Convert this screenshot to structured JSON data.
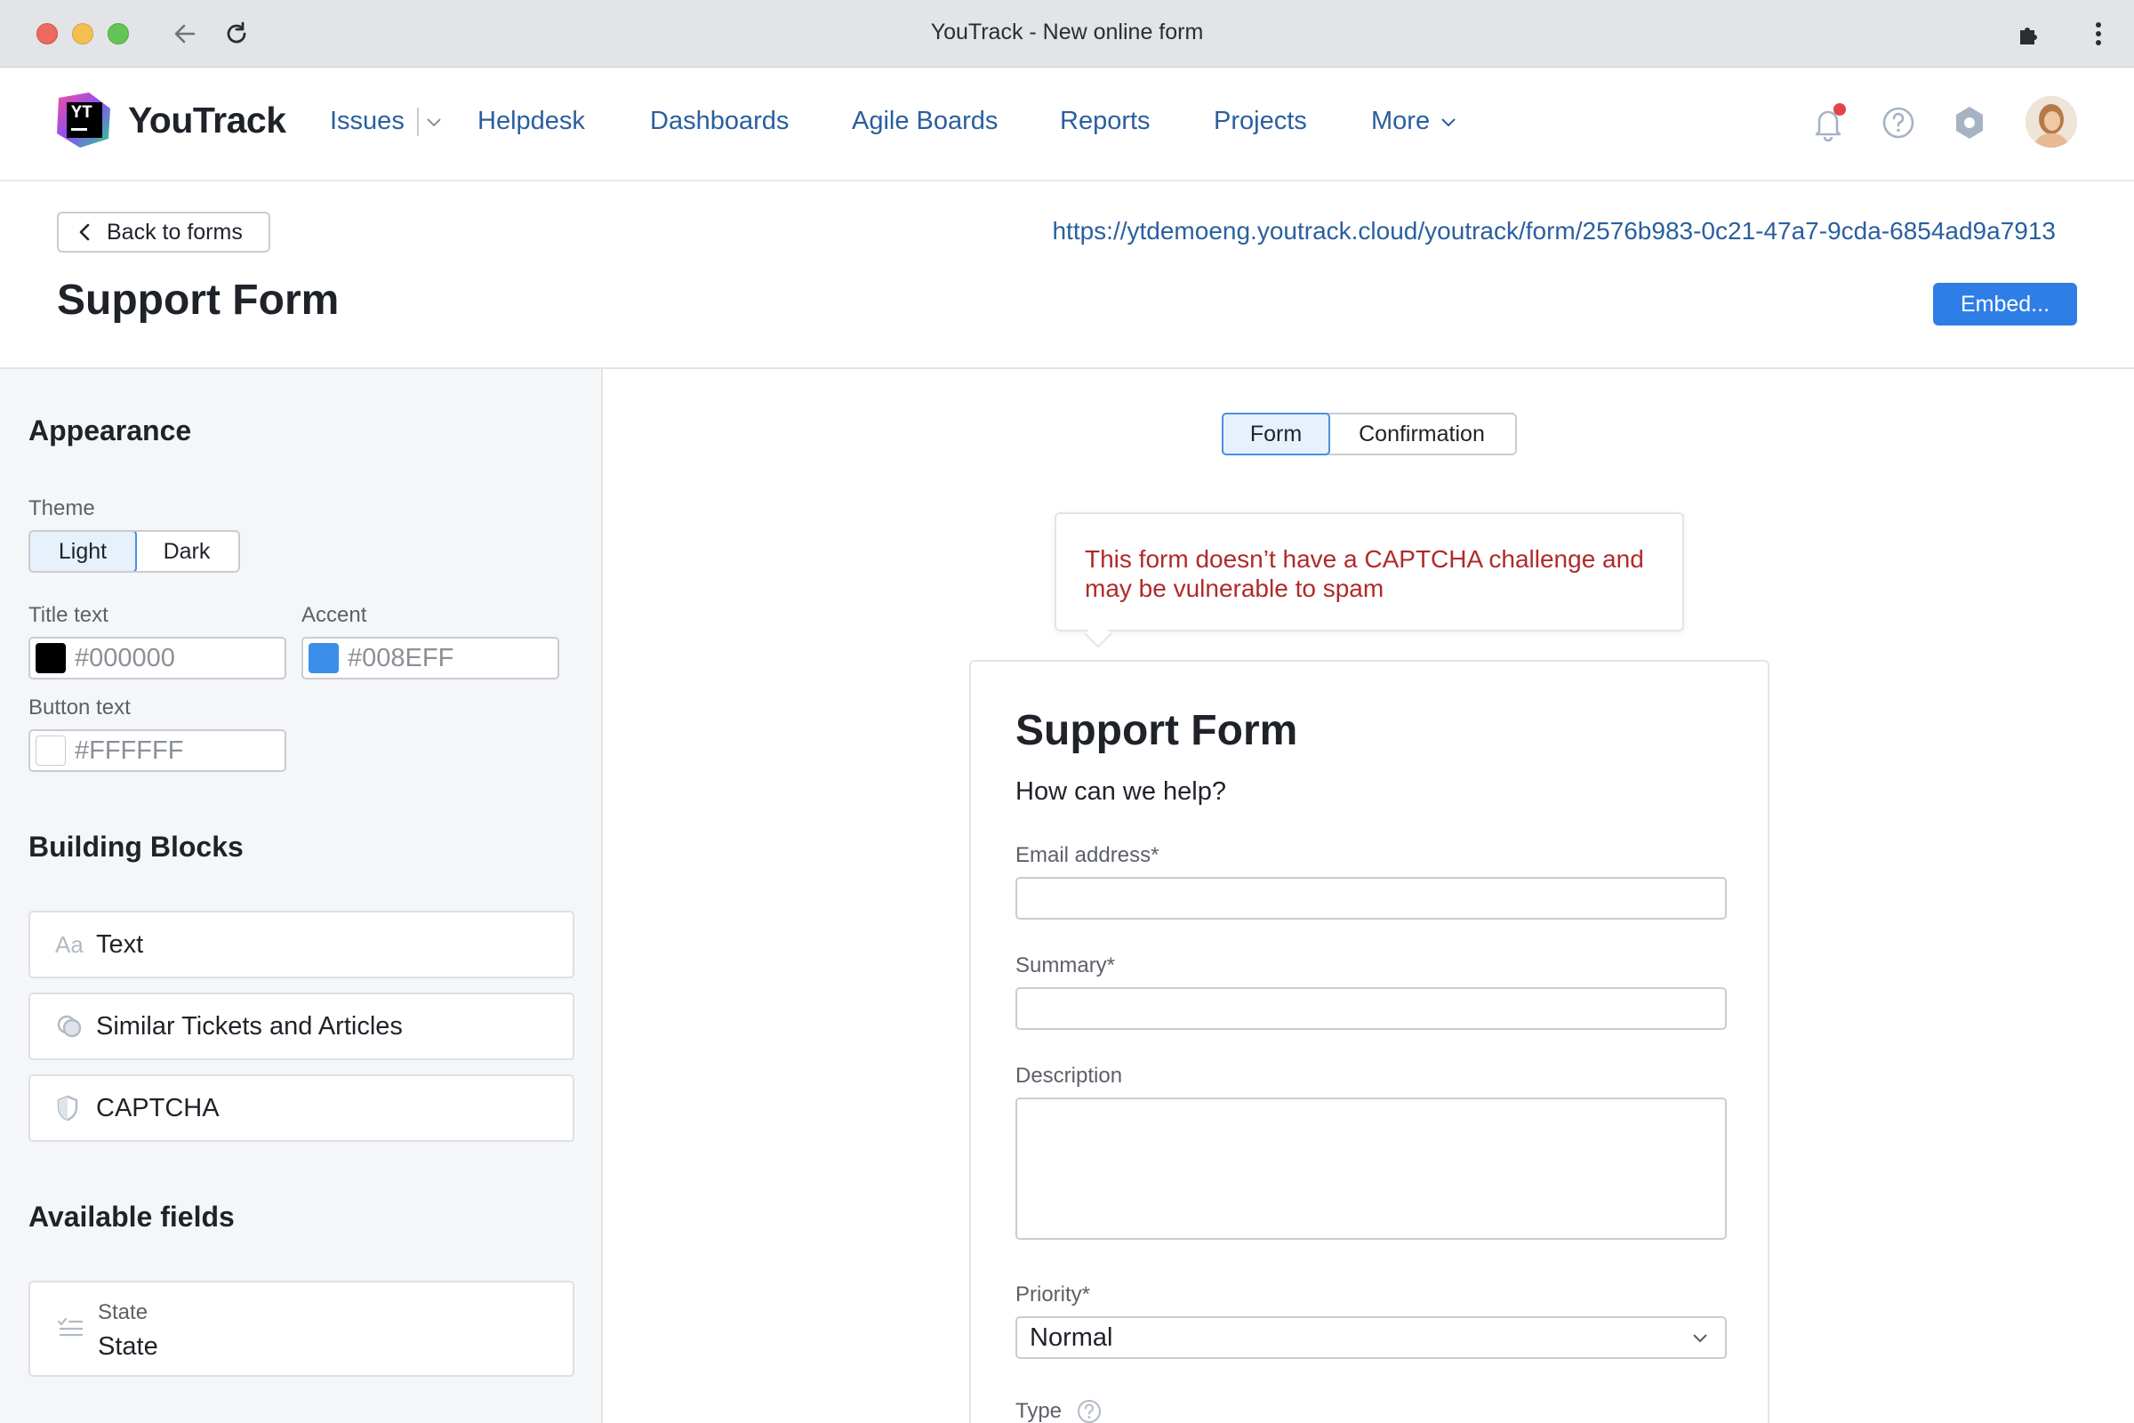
{
  "browser": {
    "title": "YouTrack - New online form"
  },
  "header": {
    "brand": "YouTrack",
    "logo_badge": "YT",
    "nav": [
      {
        "label": "Issues"
      },
      {
        "label": "Helpdesk"
      },
      {
        "label": "Dashboards"
      },
      {
        "label": "Agile Boards"
      },
      {
        "label": "Reports"
      },
      {
        "label": "Projects"
      },
      {
        "label": "More"
      }
    ],
    "icons": [
      "bell-icon",
      "help-icon",
      "gear-icon"
    ],
    "notification_color": "#e0454b"
  },
  "page": {
    "back_label": "Back to forms",
    "form_url": "https://ytdemoeng.youtrack.cloud/youtrack/form/2576b983-0c21-47a7-9cda-6854ad9a7913",
    "title": "Support Form",
    "embed_label": "Embed..."
  },
  "sidebar": {
    "appearance_heading": "Appearance",
    "theme_label": "Theme",
    "theme_options": [
      "Light",
      "Dark"
    ],
    "theme_selected": "Light",
    "title_text_label": "Title text",
    "title_text_value": "#000000",
    "accent_label": "Accent",
    "accent_value": "#008EFF",
    "button_text_label": "Button text",
    "button_text_value": "#FFFFFF",
    "building_blocks_heading": "Building Blocks",
    "blocks": [
      {
        "label": "Text",
        "icon": "text-aa-icon"
      },
      {
        "label": "Similar Tickets and Articles",
        "icon": "similar-icon"
      },
      {
        "label": "CAPTCHA",
        "icon": "shield-icon"
      }
    ],
    "available_fields_heading": "Available fields",
    "fields": [
      {
        "caption": "State",
        "name": "State",
        "icon": "state-list-icon"
      }
    ]
  },
  "preview": {
    "tabs": [
      "Form",
      "Confirmation"
    ],
    "active_tab": "Form",
    "warning": "This form doesn’t have a CAPTCHA challenge and may be vulnerable to spam",
    "form_title": "Support Form",
    "form_subtitle": "How can we help?",
    "email_label": "Email address*",
    "summary_label": "Summary*",
    "description_label": "Description",
    "priority_label": "Priority*",
    "priority_value": "Normal",
    "type_label": "Type"
  },
  "colors": {
    "link": "#2a5f9e",
    "primary_button": "#2e7ee6",
    "warning_text": "#b02a2a",
    "accent_swatch": "#3b8eea"
  }
}
